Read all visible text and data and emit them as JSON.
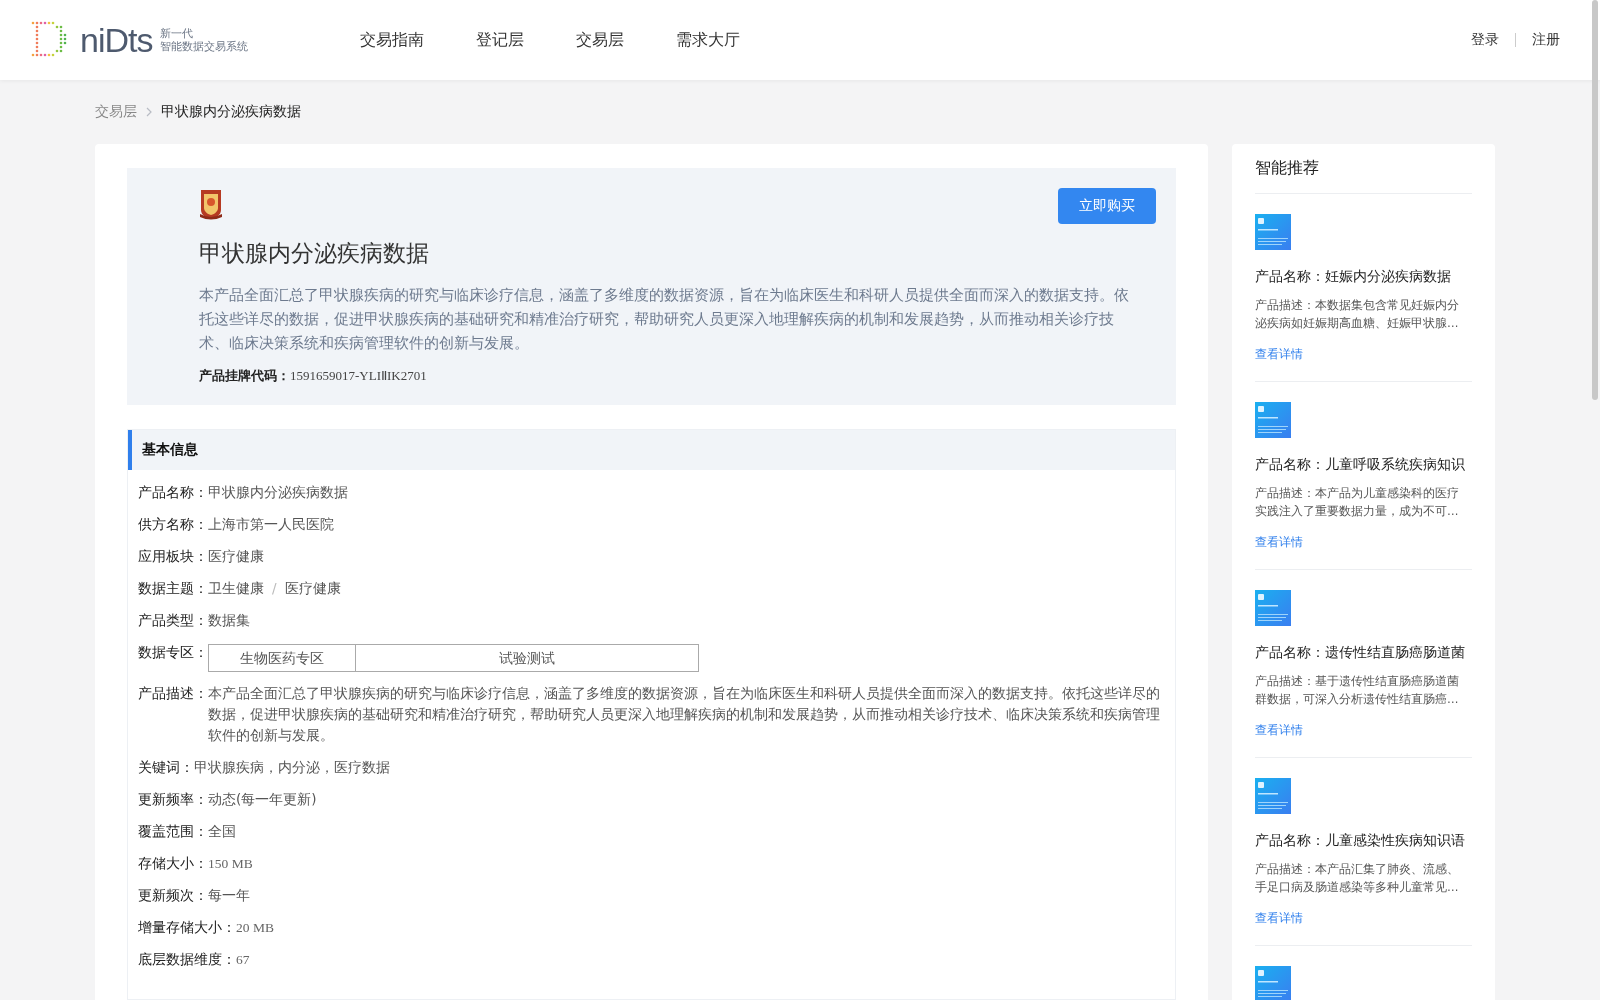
{
  "header": {
    "logo_word": "niDts",
    "logo_line1": "新一代",
    "logo_line2": "智能数据交易系统",
    "nav": [
      {
        "label": "交易指南",
        "selected": false
      },
      {
        "label": "登记层",
        "selected": false
      },
      {
        "label": "交易层",
        "selected": false
      },
      {
        "label": "需求大厅",
        "selected": false
      }
    ],
    "login": "登录",
    "register": "注册"
  },
  "breadcrumb": {
    "parent": "交易层",
    "current": "甲状腺内分泌疾病数据"
  },
  "product": {
    "title": "甲状腺内分泌疾病数据",
    "buy_button": "立即购买",
    "summary": "本产品全面汇总了甲状腺疾病的研究与临床诊疗信息，涵盖了多维度的数据资源，旨在为临床医生和科研人员提供全面而深入的数据支持。依托这些详尽的数据，促进甲状腺疾病的基础研究和精准治疗研究，帮助研究人员更深入地理解疾病的机制和发展趋势，从而推动相关诊疗技术、临床决策系统和疾病管理软件的创新与发展。",
    "code_label": "产品挂牌代码：",
    "code": "1591659017-YLIⅡIK2701"
  },
  "basic_info": {
    "heading": "基本信息",
    "fields": [
      {
        "kind": "text",
        "label": "产品名称：",
        "value": "甲状腺内分泌疾病数据"
      },
      {
        "kind": "text",
        "label": "供方名称：",
        "value": "上海市第一人民医院"
      },
      {
        "kind": "text",
        "label": "应用板块：",
        "value": "医疗健康"
      },
      {
        "kind": "path",
        "label": "数据主题：",
        "parts": [
          "卫生健康",
          "医疗健康"
        ],
        "separator": "/"
      },
      {
        "kind": "text",
        "label": "产品类型：",
        "value": "数据集"
      },
      {
        "kind": "zones",
        "label": "数据专区：",
        "cells": [
          "生物医药专区",
          "试验测试"
        ]
      },
      {
        "kind": "text",
        "label": "产品描述：",
        "value": "本产品全面汇总了甲状腺疾病的研究与临床诊疗信息，涵盖了多维度的数据资源，旨在为临床医生和科研人员提供全面而深入的数据支持。依托这些详尽的数据，促进甲状腺疾病的基础研究和精准治疗研究，帮助研究人员更深入地理解疾病的机制和发展趋势，从而推动相关诊疗技术、临床决策系统和疾病管理软件的创新与发展。"
      },
      {
        "kind": "text",
        "label": "关键词：",
        "value": "甲状腺疾病，内分泌，医疗数据"
      },
      {
        "kind": "text",
        "label": "更新频率：",
        "value": "动态(每一年更新)"
      },
      {
        "kind": "text",
        "label": "覆盖范围：",
        "value": "全国"
      },
      {
        "kind": "mono",
        "label": "存储大小：",
        "value": "150 MB"
      },
      {
        "kind": "text",
        "label": "更新频次：",
        "value": "每一年"
      },
      {
        "kind": "mono",
        "label": "增量存储大小：",
        "value": "20 MB"
      },
      {
        "kind": "mono",
        "label": "底层数据维度：",
        "value": "67"
      }
    ]
  },
  "recommendations": {
    "heading": "智能推荐",
    "items": [
      {
        "kind": "product",
        "name": "产品名称：妊娠内分泌疾病数据",
        "description": "产品描述：本数据集包含常见妊娠内分泌疾病如妊娠期高血糖、妊娠甲状腺…",
        "link": "查看详情"
      },
      {
        "kind": "product",
        "name": "产品名称：儿童呼吸系统疾病知识",
        "description": "产品描述：本产品为儿童感染科的医疗实践注入了重要数据力量，成为不可…",
        "link": "查看详情"
      },
      {
        "kind": "product",
        "name": "产品名称：遗传性结直肠癌肠道菌",
        "description": "产品描述：基于遗传性结直肠癌肠道菌群数据，可深入分析遗传性结直肠癌…",
        "link": "查看详情"
      },
      {
        "kind": "product",
        "name": "产品名称：儿童感染性疾病知识语",
        "description": "产品描述：本产品汇集了肺炎、流感、手足口病及肠道感染等多种儿童常见…",
        "link": "查看详情"
      },
      {
        "kind": "picture"
      }
    ]
  }
}
